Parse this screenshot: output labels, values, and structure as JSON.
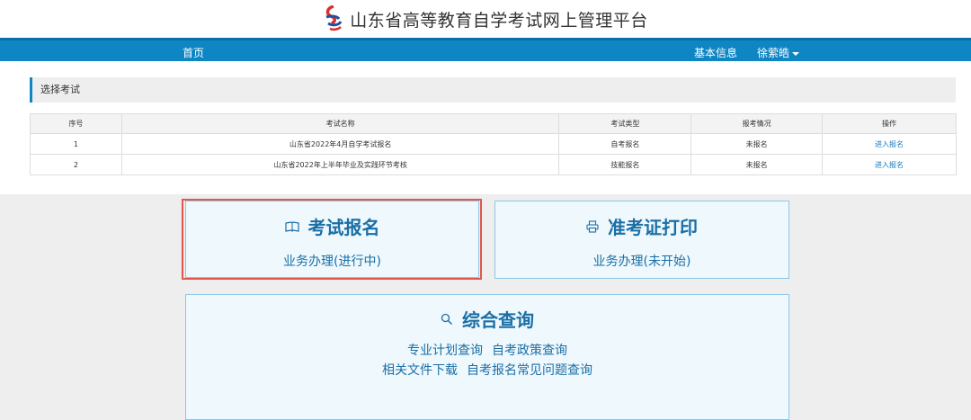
{
  "header": {
    "title": "山东省高等教育自学考试网上管理平台"
  },
  "navbar": {
    "home": "首页",
    "info": "基本信息",
    "user": "徐萦皓"
  },
  "section": {
    "title": "选择考试"
  },
  "table": {
    "headers": [
      "序号",
      "考试名称",
      "考试类型",
      "报考情况",
      "操作"
    ],
    "rows": [
      [
        "1",
        "山东省2022年4月自学考试报名",
        "自考报名",
        "未报名",
        "进入报名"
      ],
      [
        "2",
        "山东省2022年上半年毕业及实践环节考核",
        "技能报名",
        "未报名",
        "进入报名"
      ]
    ]
  },
  "cards": {
    "exam_register": {
      "title": "考试报名",
      "status": "业务办理(进行中)"
    },
    "admission_print": {
      "title": "准考证打印",
      "status": "业务办理(未开始)"
    },
    "query": {
      "title": "综合查询",
      "links_row1": [
        "专业计划查询",
        "自考政策查询"
      ],
      "links_row2": [
        "相关文件下载",
        "自考报名常见问题查询"
      ]
    }
  },
  "colors": {
    "nav": "#0e86c4",
    "card_bg": "#eef8fd",
    "card_border": "#8cc7e6",
    "highlight": "#e2574c",
    "link": "#1a7bb9"
  }
}
